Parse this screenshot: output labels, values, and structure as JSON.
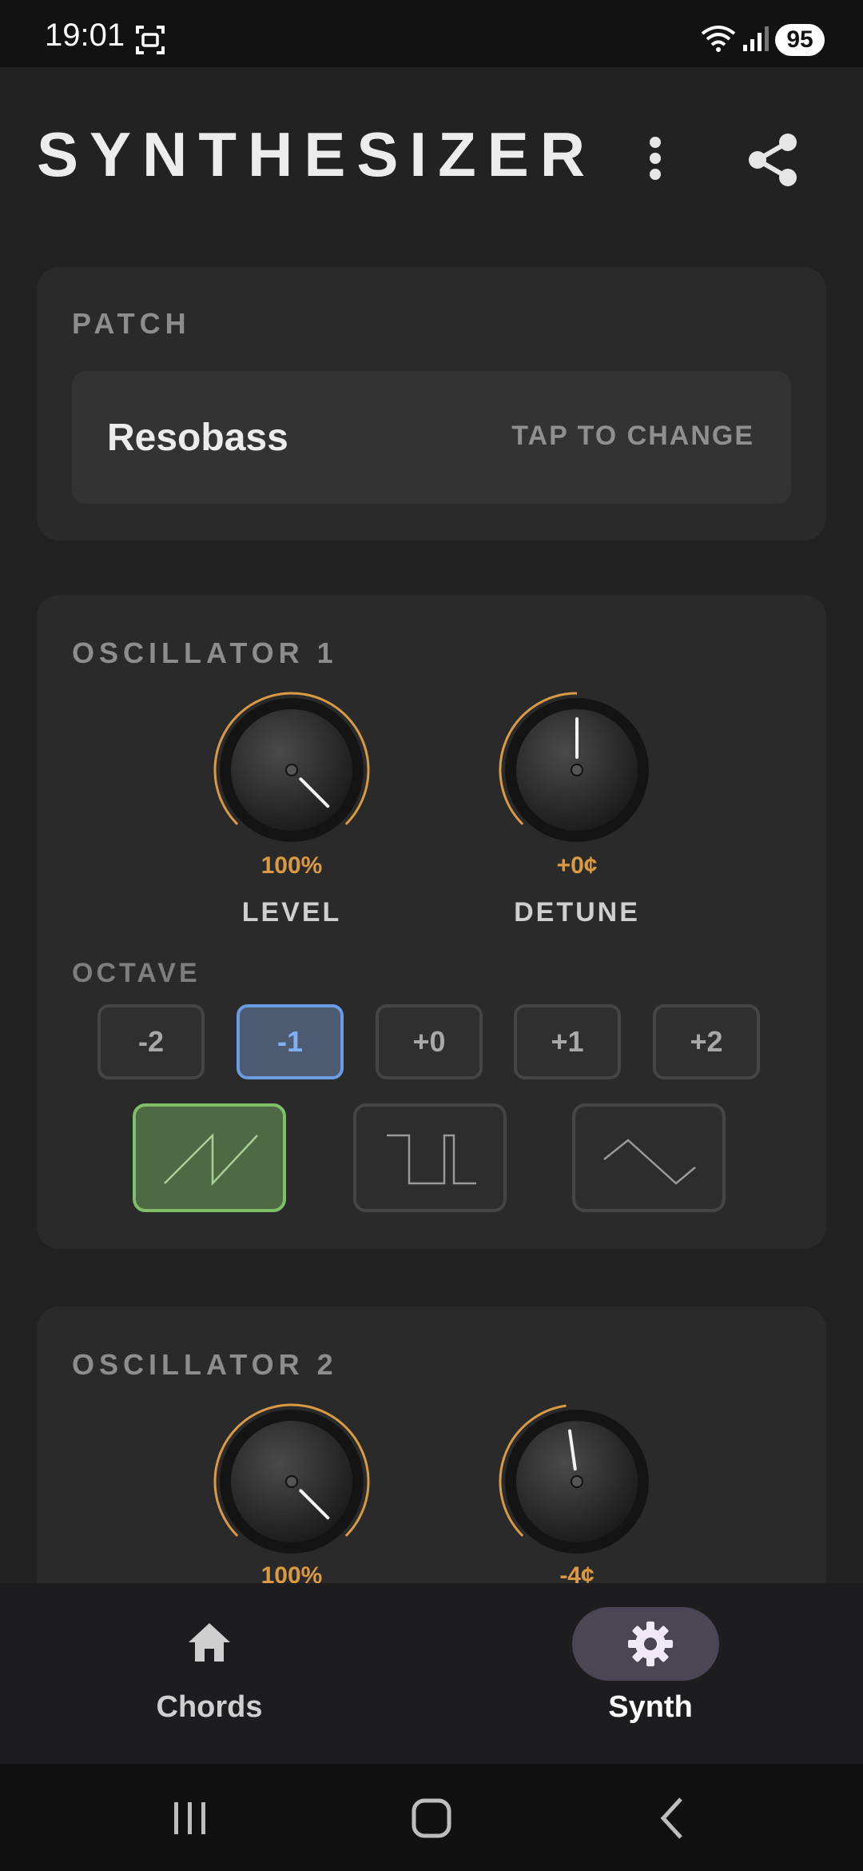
{
  "status_bar": {
    "time": "19:01",
    "battery": "95"
  },
  "header": {
    "title": "SYNTHESIZER",
    "more_icon": "more-vert-icon",
    "share_icon": "share-icon"
  },
  "patch": {
    "label": "PATCH",
    "name": "Resobass",
    "hint": "TAP TO CHANGE"
  },
  "oscillator1": {
    "label": "OSCILLATOR 1",
    "level": {
      "value": "100%",
      "label": "LEVEL",
      "fraction": 1.0
    },
    "detune": {
      "value": "+0¢",
      "label": "DETUNE",
      "fraction": 0.5
    },
    "octave_label": "OCTAVE",
    "octaves": [
      "-2",
      "-1",
      "+0",
      "+1",
      "+2"
    ],
    "selected_octave": "-1",
    "waveforms": [
      "sawtooth",
      "square",
      "triangle"
    ],
    "selected_waveform": "sawtooth"
  },
  "oscillator2": {
    "label": "OSCILLATOR 2",
    "level": {
      "value": "100%",
      "fraction": 1.0
    },
    "detune": {
      "value": "-4¢",
      "fraction": 0.47
    }
  },
  "bottom_nav": {
    "items": [
      {
        "label": "Chords",
        "icon": "home-icon"
      },
      {
        "label": "Synth",
        "icon": "gear-icon"
      }
    ],
    "active": "Synth"
  },
  "colors": {
    "accent_orange": "#d99a43",
    "octave_selected": "#6a9be3",
    "wave_selected": "#7fbf6a"
  }
}
